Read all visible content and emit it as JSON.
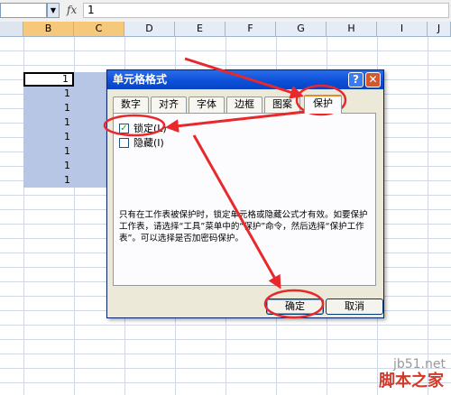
{
  "formula_bar": {
    "name_box": "",
    "fx": "fx",
    "value": "1"
  },
  "columns": [
    "B",
    "C",
    "D",
    "E",
    "F",
    "G",
    "H",
    "I",
    "J"
  ],
  "cells": [
    "1",
    "1",
    "1",
    "1",
    "1",
    "1",
    "1",
    "1"
  ],
  "dialog": {
    "title": "单元格格式",
    "help_button": "?",
    "close_button": "✕",
    "tabs": [
      "数字",
      "对齐",
      "字体",
      "边框",
      "图案",
      "保护"
    ],
    "active_tab": "保护",
    "locked_label": "锁定(L)",
    "locked_checked": true,
    "hidden_label": "隐藏(I)",
    "hidden_checked": false,
    "description": "只有在工作表被保护时，锁定单元格或隐藏公式才有效。如要保护工作表，请选择“工具”菜单中的“保护”命令，然后选择“保护工作表”。可以选择是否加密码保护。",
    "ok_label": "确定",
    "cancel_label": "取消"
  },
  "watermark": {
    "site": "jb51.net",
    "brand": "脚本之家"
  },
  "colors": {
    "annotation": "#e8282b",
    "selection": "#b6c6e4",
    "titlebar": "#0b4fd8"
  }
}
